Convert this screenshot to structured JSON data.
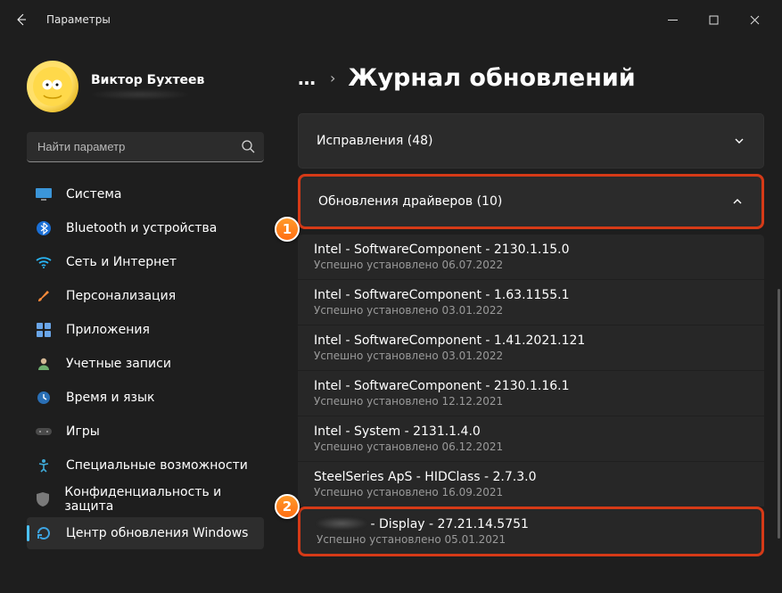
{
  "window": {
    "title": "Параметры"
  },
  "profile": {
    "name": "Виктор Бухтеев"
  },
  "search": {
    "placeholder": "Найти параметр"
  },
  "sidebar": {
    "items": [
      {
        "label": "Система"
      },
      {
        "label": "Bluetooth и устройства"
      },
      {
        "label": "Сеть и Интернет"
      },
      {
        "label": "Персонализация"
      },
      {
        "label": "Приложения"
      },
      {
        "label": "Учетные записи"
      },
      {
        "label": "Время и язык"
      },
      {
        "label": "Игры"
      },
      {
        "label": "Специальные возможности"
      },
      {
        "label": "Конфиденциальность и защита"
      },
      {
        "label": "Центр обновления Windows"
      }
    ]
  },
  "page": {
    "title": "Журнал обновлений",
    "collapsed": {
      "label": "Исправления (48)"
    },
    "expanded": {
      "label": "Обновления драйверов (10)"
    },
    "updates": [
      {
        "title": "Intel - SoftwareComponent - 2130.1.15.0",
        "sub": "Успешно установлено 06.07.2022"
      },
      {
        "title": "Intel - SoftwareComponent - 1.63.1155.1",
        "sub": "Успешно установлено 03.01.2022"
      },
      {
        "title": "Intel - SoftwareComponent - 1.41.2021.121",
        "sub": "Успешно установлено 03.01.2022"
      },
      {
        "title": "Intel - SoftwareComponent - 2130.1.16.1",
        "sub": "Успешно установлено 12.12.2021"
      },
      {
        "title": "Intel - System - 2131.1.4.0",
        "sub": "Успешно установлено 06.12.2021"
      },
      {
        "title": "SteelSeries ApS - HIDClass - 2.7.3.0",
        "sub": "Успешно установлено 16.09.2021"
      }
    ],
    "last": {
      "suffix": " - Display - 27.21.14.5751",
      "sub": "Успешно установлено 05.01.2021"
    }
  },
  "badges": {
    "one": "1",
    "two": "2"
  }
}
